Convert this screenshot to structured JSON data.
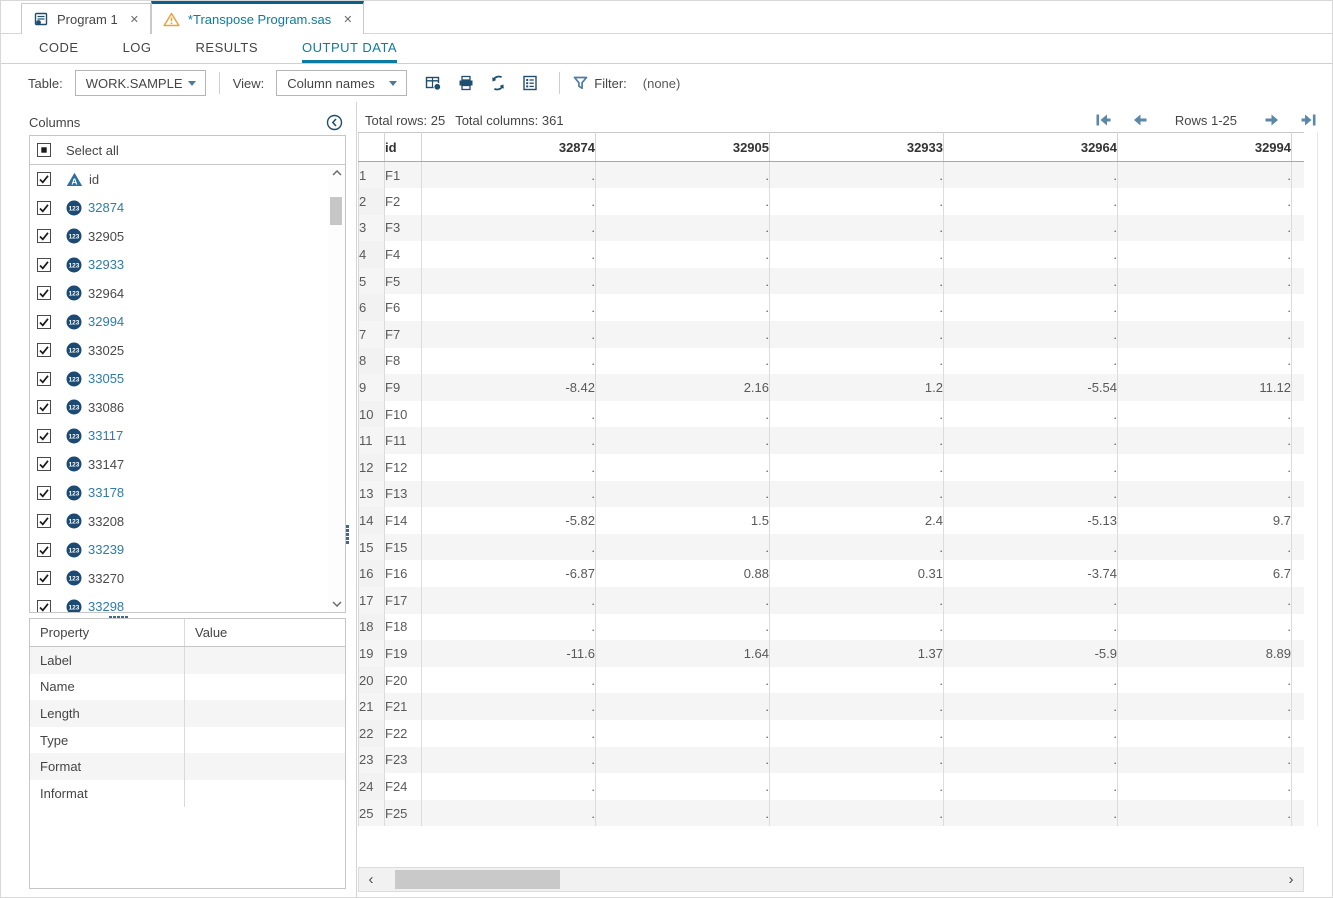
{
  "window": {
    "tabs": [
      {
        "label": "Program 1",
        "active": false,
        "icon": "program-icon",
        "close_icon": "close-icon"
      },
      {
        "label": "*Transpose Program.sas",
        "active": true,
        "icon": "warning-icon",
        "close_icon": "close-icon"
      }
    ]
  },
  "subtabs": {
    "items": [
      "CODE",
      "LOG",
      "RESULTS",
      "OUTPUT DATA"
    ],
    "active": "OUTPUT DATA"
  },
  "toolbar": {
    "table_label": "Table:",
    "table_value": "WORK.SAMPLE",
    "view_label": "View:",
    "view_value": "Column names",
    "icons": [
      "table-export-icon",
      "printer-icon",
      "refresh-icon",
      "properties-icon",
      "filter-icon"
    ],
    "filter_label": "Filter:",
    "filter_value": "(none)"
  },
  "columns_panel": {
    "title": "Columns",
    "collapse_icon": "collapse-panel-icon",
    "select_all_label": "Select all",
    "select_all_state": "indeterminate",
    "items": [
      {
        "name": "id",
        "type": "char",
        "checked": true,
        "highlight": false
      },
      {
        "name": "32874",
        "type": "num",
        "checked": true,
        "highlight": true
      },
      {
        "name": "32905",
        "type": "num",
        "checked": true,
        "highlight": false
      },
      {
        "name": "32933",
        "type": "num",
        "checked": true,
        "highlight": true
      },
      {
        "name": "32964",
        "type": "num",
        "checked": true,
        "highlight": false
      },
      {
        "name": "32994",
        "type": "num",
        "checked": true,
        "highlight": true
      },
      {
        "name": "33025",
        "type": "num",
        "checked": true,
        "highlight": false
      },
      {
        "name": "33055",
        "type": "num",
        "checked": true,
        "highlight": true
      },
      {
        "name": "33086",
        "type": "num",
        "checked": true,
        "highlight": false
      },
      {
        "name": "33117",
        "type": "num",
        "checked": true,
        "highlight": true
      },
      {
        "name": "33147",
        "type": "num",
        "checked": true,
        "highlight": false
      },
      {
        "name": "33178",
        "type": "num",
        "checked": true,
        "highlight": true
      },
      {
        "name": "33208",
        "type": "num",
        "checked": true,
        "highlight": false
      },
      {
        "name": "33239",
        "type": "num",
        "checked": true,
        "highlight": true
      },
      {
        "name": "33270",
        "type": "num",
        "checked": true,
        "highlight": false
      },
      {
        "name": "33298",
        "type": "num",
        "checked": true,
        "highlight": true
      }
    ]
  },
  "properties_panel": {
    "headers": [
      "Property",
      "Value"
    ],
    "rows": [
      {
        "property": "Label",
        "value": ""
      },
      {
        "property": "Name",
        "value": ""
      },
      {
        "property": "Length",
        "value": ""
      },
      {
        "property": "Type",
        "value": ""
      },
      {
        "property": "Format",
        "value": ""
      },
      {
        "property": "Informat",
        "value": ""
      }
    ]
  },
  "grid": {
    "total_rows_label": "Total rows: 25",
    "total_columns_label": "Total columns: 361",
    "pagination_label": "Rows 1-25",
    "columns": [
      "id",
      "32874",
      "32905",
      "32933",
      "32964",
      "32994"
    ],
    "rows": [
      {
        "n": "1",
        "id": "F1",
        "values": [
          ".",
          ".",
          ".",
          ".",
          "."
        ]
      },
      {
        "n": "2",
        "id": "F2",
        "values": [
          ".",
          ".",
          ".",
          ".",
          "."
        ]
      },
      {
        "n": "3",
        "id": "F3",
        "values": [
          ".",
          ".",
          ".",
          ".",
          "."
        ]
      },
      {
        "n": "4",
        "id": "F4",
        "values": [
          ".",
          ".",
          ".",
          ".",
          "."
        ]
      },
      {
        "n": "5",
        "id": "F5",
        "values": [
          ".",
          ".",
          ".",
          ".",
          "."
        ]
      },
      {
        "n": "6",
        "id": "F6",
        "values": [
          ".",
          ".",
          ".",
          ".",
          "."
        ]
      },
      {
        "n": "7",
        "id": "F7",
        "values": [
          ".",
          ".",
          ".",
          ".",
          "."
        ]
      },
      {
        "n": "8",
        "id": "F8",
        "values": [
          ".",
          ".",
          ".",
          ".",
          "."
        ]
      },
      {
        "n": "9",
        "id": "F9",
        "values": [
          "-8.42",
          "2.16",
          "1.2",
          "-5.54",
          "11.12"
        ]
      },
      {
        "n": "10",
        "id": "F10",
        "values": [
          ".",
          ".",
          ".",
          ".",
          "."
        ]
      },
      {
        "n": "11",
        "id": "F11",
        "values": [
          ".",
          ".",
          ".",
          ".",
          "."
        ]
      },
      {
        "n": "12",
        "id": "F12",
        "values": [
          ".",
          ".",
          ".",
          ".",
          "."
        ]
      },
      {
        "n": "13",
        "id": "F13",
        "values": [
          ".",
          ".",
          ".",
          ".",
          "."
        ]
      },
      {
        "n": "14",
        "id": "F14",
        "values": [
          "-5.82",
          "1.5",
          "2.4",
          "-5.13",
          "9.7"
        ]
      },
      {
        "n": "15",
        "id": "F15",
        "values": [
          ".",
          ".",
          ".",
          ".",
          "."
        ]
      },
      {
        "n": "16",
        "id": "F16",
        "values": [
          "-6.87",
          "0.88",
          "0.31",
          "-3.74",
          "6.7"
        ]
      },
      {
        "n": "17",
        "id": "F17",
        "values": [
          ".",
          ".",
          ".",
          ".",
          "."
        ]
      },
      {
        "n": "18",
        "id": "F18",
        "values": [
          ".",
          ".",
          ".",
          ".",
          "."
        ]
      },
      {
        "n": "19",
        "id": "F19",
        "values": [
          "-11.6",
          "1.64",
          "1.37",
          "-5.9",
          "8.89"
        ]
      },
      {
        "n": "20",
        "id": "F20",
        "values": [
          ".",
          ".",
          ".",
          ".",
          "."
        ]
      },
      {
        "n": "21",
        "id": "F21",
        "values": [
          ".",
          ".",
          ".",
          ".",
          "."
        ]
      },
      {
        "n": "22",
        "id": "F22",
        "values": [
          ".",
          ".",
          ".",
          ".",
          "."
        ]
      },
      {
        "n": "23",
        "id": "F23",
        "values": [
          ".",
          ".",
          ".",
          ".",
          "."
        ]
      },
      {
        "n": "24",
        "id": "F24",
        "values": [
          ".",
          ".",
          ".",
          ".",
          "."
        ]
      },
      {
        "n": "25",
        "id": "F25",
        "values": [
          ".",
          ".",
          ".",
          ".",
          "."
        ]
      }
    ]
  },
  "colors": {
    "accent_teal": "#0c7ba0",
    "active_tab_border": "#0b608a",
    "icon_navy": "#1f4e6f",
    "column_link_teal": "#2e7ca8",
    "warning_yellow": "#e8a33d",
    "steel_blue": "#5b87a8",
    "row_stripe": "#f5f5f5",
    "rownum_bg": "#f2f2f2"
  }
}
